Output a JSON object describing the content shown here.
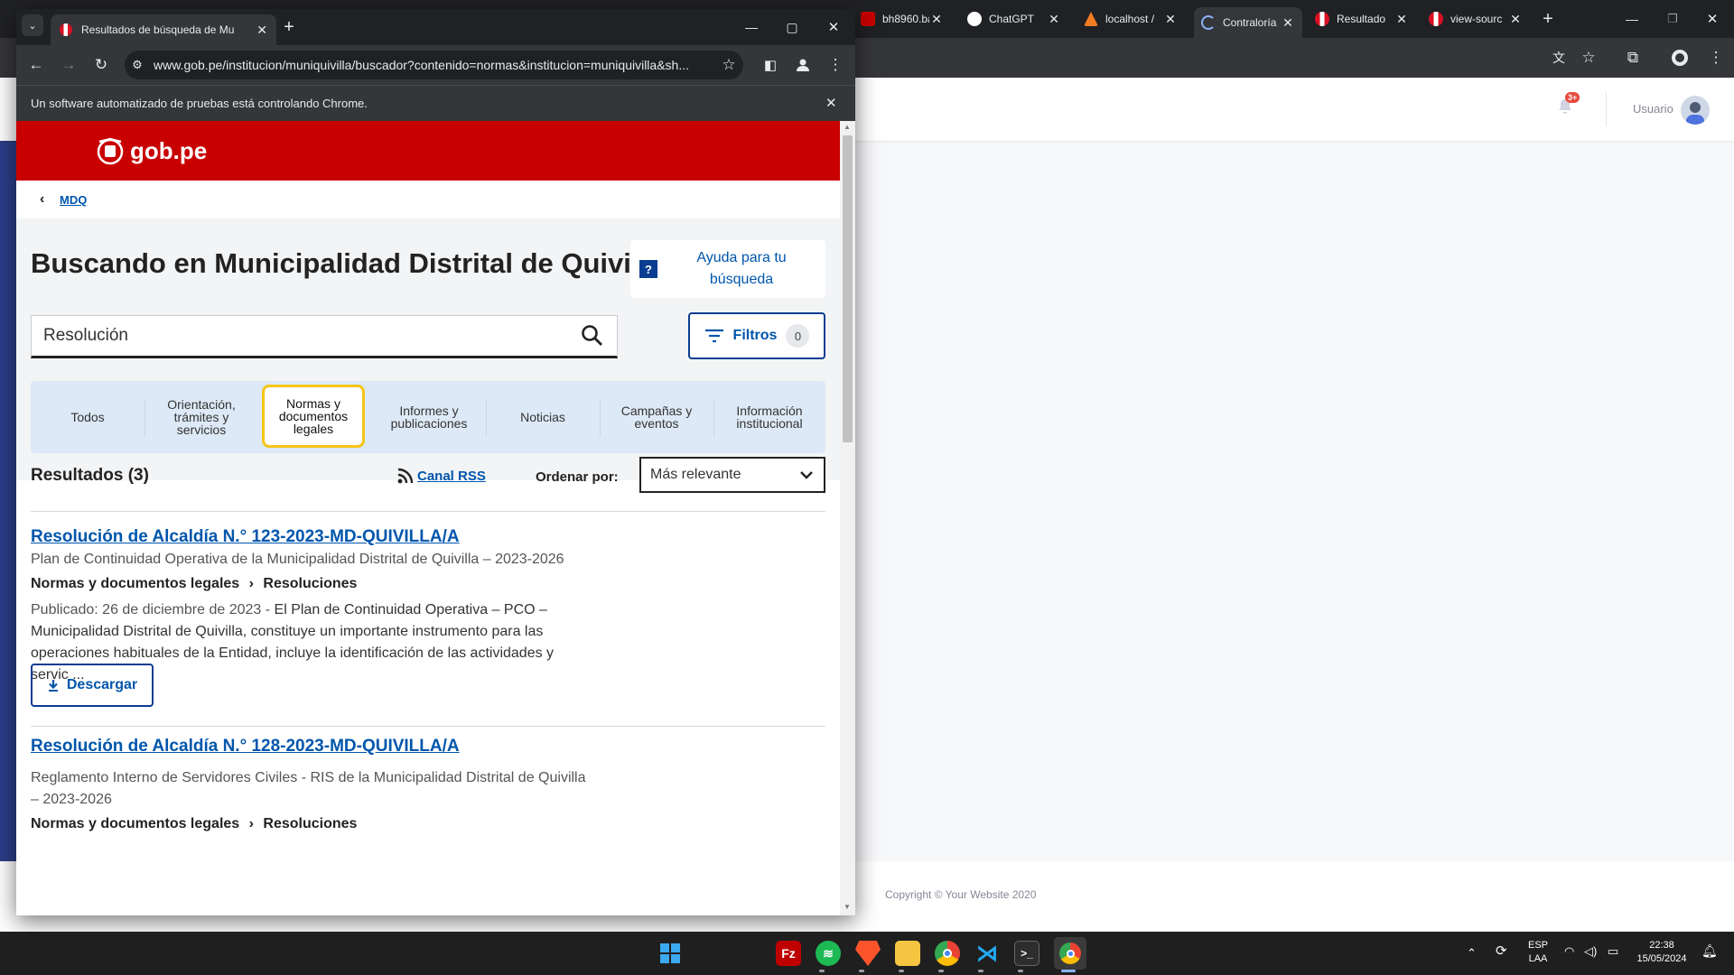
{
  "background_window": {
    "tabs": [
      {
        "title": "bh8960.ba",
        "favicon": "gob-icon"
      },
      {
        "title": "ChatGPT",
        "favicon": "chatgpt-icon"
      },
      {
        "title": "localhost /",
        "favicon": "xampp-icon"
      },
      {
        "title": "Contraloría",
        "favicon": "loading-icon"
      },
      {
        "title": "Resultado",
        "favicon": "peru-flag-icon"
      },
      {
        "title": "view-sourc",
        "favicon": "peru-flag-icon"
      }
    ],
    "user_label": "Usuario",
    "notification_badge": "3+",
    "footer_text": "Copyright © Your Website 2020"
  },
  "foreground_window": {
    "tab_title": "Resultados de búsqueda de Mu",
    "url": "www.gob.pe/institucion/muniquivilla/buscador?contenido=normas&institucion=muniquivilla&sh...",
    "infobar_text": "Un software automatizado de pruebas está controlando Chrome."
  },
  "page": {
    "logo_text": "gob.pe",
    "back_link": "MDQ",
    "heading": "Buscando en Municipalidad Distrital de Quivilla",
    "help_button": "Ayuda para tu búsqueda",
    "search_value": "Resolución",
    "filters_label": "Filtros",
    "filters_count": "0",
    "categories": [
      {
        "label": "Todos",
        "selected": false
      },
      {
        "label": "Orientación, trámites y servicios",
        "selected": false
      },
      {
        "label": "Normas y documentos legales",
        "selected": true
      },
      {
        "label": "Informes y publicaciones",
        "selected": false
      },
      {
        "label": "Noticias",
        "selected": false
      },
      {
        "label": "Campañas y eventos",
        "selected": false
      },
      {
        "label": "Información institucional",
        "selected": false
      }
    ],
    "results_label": "Resultados (3)",
    "rss_label": "Canal RSS",
    "sort_label": "Ordenar por:",
    "sort_value": "Más relevante",
    "results": [
      {
        "title": "Resolución de Alcaldía N.° 123-2023-MD-QUIVILLA/A",
        "subtitle": "Plan de Continuidad Operativa de la Municipalidad Distrital de Quivilla – 2023-2026",
        "category": "Normas y documentos legales",
        "subcategory": "Resoluciones",
        "published_prefix": "Publicado: 26 de diciembre de 2023 - ",
        "summary": "El Plan de Continuidad Operativa – PCO – Municipalidad Distrital de Quivilla, constituye un importante instrumento para las operaciones habituales de  la Entidad, incluye la identificación de las actividades y servic ...",
        "download_label": "Descargar"
      },
      {
        "title": "Resolución de Alcaldía N.° 128-2023-MD-QUIVILLA/A",
        "subtitle": "Reglamento Interno de Servidores Civiles - RIS de la Municipalidad Distrital de Quivilla – 2023-2026",
        "category": "Normas y documentos legales",
        "subcategory": "Resoluciones"
      }
    ],
    "breadcrumb_separator": "›"
  },
  "taskbar": {
    "apps": [
      "start-icon",
      "filezilla-icon",
      "spotify-icon",
      "brave-icon",
      "file-explorer-icon",
      "chrome-canary-icon",
      "vscode-icon",
      "terminal-icon",
      "chrome-icon"
    ],
    "lang_top": "ESP",
    "lang_bottom": "LAA",
    "time": "22:38",
    "date": "15/05/2024"
  },
  "colors": {
    "gob_red": "#c80000",
    "link_blue": "#0056ac",
    "selected_tab_border": "#f5c518",
    "chrome_dark": "#202124"
  }
}
